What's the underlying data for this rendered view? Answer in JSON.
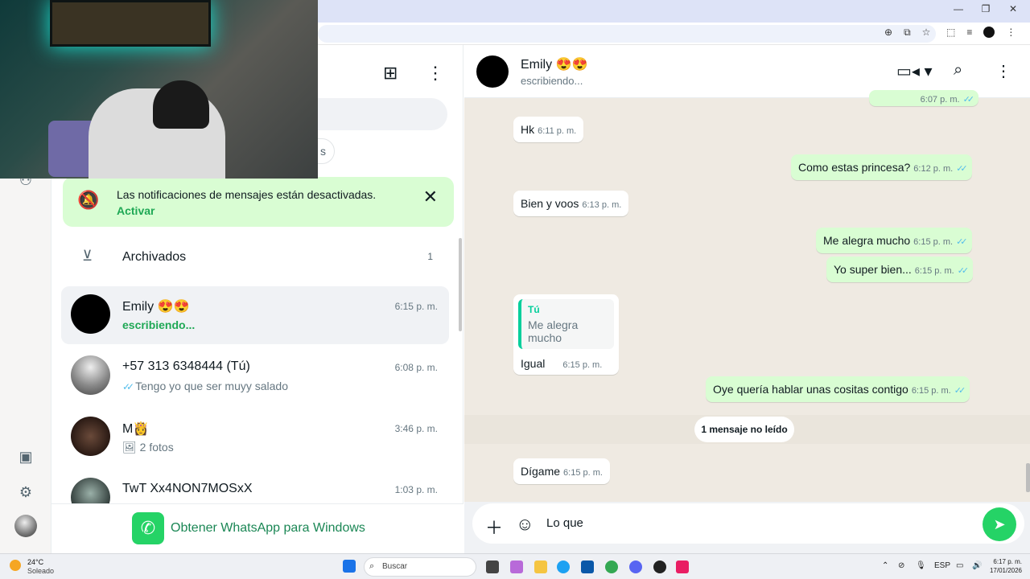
{
  "browser": {
    "window_controls": [
      "—",
      "❐",
      "✕"
    ],
    "toolbar_icons": [
      "zoom-icon",
      "install-icon",
      "star-icon"
    ],
    "toolbar_icons_right": [
      "extensions-icon",
      "media-icon",
      "profile-icon",
      "menu-icon"
    ]
  },
  "rail": {
    "icons": [
      "media-gallery-icon",
      "settings-icon"
    ]
  },
  "list": {
    "header_icons": [
      "new-chat-icon",
      "menu-icon"
    ],
    "chip_fragment": "s",
    "notification": {
      "text": "Las notificaciones de mensajes están desactivadas.",
      "action": "Activar"
    },
    "archived": {
      "label": "Archivados",
      "count": "1"
    },
    "chats": [
      {
        "name": "Emily 😍😍",
        "time": "6:15 p. m.",
        "sub": "escribiendo...",
        "typing": true
      },
      {
        "name": "+57 313 6348444 (Tú)",
        "time": "6:08 p. m.",
        "sub": "Tengo yo que ser muyy salado",
        "ticks": "✓✓"
      },
      {
        "name": "M👸",
        "time": "3:46 p. m.",
        "sub": "2 fotos",
        "photo_icon": "🖼"
      },
      {
        "name": "TwT Xx4NON7MOSxX",
        "time": "1:03 p. m.",
        "sub": ""
      }
    ],
    "get_whatsapp": "Obtener WhatsApp para Windows"
  },
  "conversation": {
    "contact_name": "Emily 😍😍",
    "status": "escribiendo...",
    "header_icons": [
      "video-call-icon",
      "search-icon",
      "menu-icon"
    ],
    "messages": [
      {
        "dir": "out",
        "text": "",
        "time": "6:07 p. m.",
        "ticks": "✓✓"
      },
      {
        "dir": "in",
        "text": "Hk",
        "time": "6:11 p. m."
      },
      {
        "dir": "out",
        "text": "Como estas princesa?",
        "time": "6:12 p. m.",
        "ticks": "✓✓"
      },
      {
        "dir": "in",
        "text": "Bien y voos",
        "time": "6:13 p. m."
      },
      {
        "dir": "out",
        "text": "Me alegra mucho",
        "time": "6:15 p. m.",
        "ticks": "✓✓"
      },
      {
        "dir": "out",
        "text": "Yo super bien...",
        "time": "6:15 p. m.",
        "ticks": "✓✓"
      },
      {
        "dir": "in",
        "quote_author": "Tú",
        "quote_text": "Me alegra mucho",
        "text": "Igual",
        "time": "6:15 p. m."
      },
      {
        "dir": "out",
        "text": "Oye quería hablar unas cositas contigo",
        "time": "6:15 p. m.",
        "ticks": "✓✓"
      },
      {
        "dir": "in",
        "text": "Dígame",
        "time": "6:15 p. m."
      }
    ],
    "unread_label": "1 mensaje no leído",
    "compose": {
      "value": "Lo que",
      "icons": [
        "plus-icon",
        "sticker-icon",
        "send-icon"
      ]
    }
  },
  "taskbar": {
    "weather_temp": "24°C",
    "weather_cond": "Soleado",
    "search_placeholder": "Buscar",
    "lang": "ESP",
    "time": "6:17 p. m.",
    "date": "17/01/2026"
  }
}
